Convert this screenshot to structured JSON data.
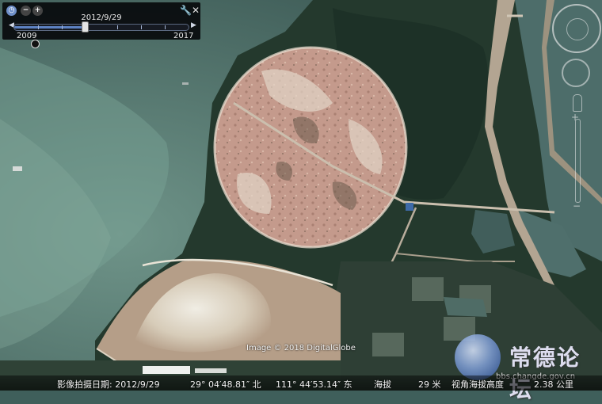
{
  "timeslider": {
    "current_date": "2012/9/29",
    "start_year": "2009",
    "end_year": "2017",
    "position_fraction": 0.4,
    "icons": [
      "clock-icon",
      "zoom-out-icon",
      "zoom-in-icon",
      "wrench-icon",
      "close-icon"
    ]
  },
  "copyright": "Image © 2018 DigitalGlobe",
  "watermark": {
    "name": "常德论坛",
    "url": "bbs.changde.gov.cn"
  },
  "status": {
    "capture_date_label": "影像拍摄日期: 2012/9/29",
    "latitude": "29° 04′48.81″ 北",
    "longitude": "111° 44′53.14″ 东",
    "elevation_label": "海拔",
    "elevation_value": "29 米",
    "eye_alt_label": "视角海拔高度",
    "eye_alt_value": "2.38 公里"
  },
  "colors": {
    "water": "#3f5f5b",
    "cleared_land": "#c79a8a",
    "vegetation": "#22392c",
    "sand": "#d8c8b4"
  }
}
